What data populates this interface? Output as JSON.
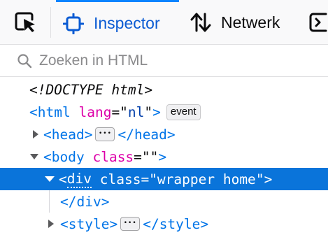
{
  "toolbar": {
    "tabs": [
      {
        "label": "Inspector",
        "icon": "inspector-icon",
        "active": true
      },
      {
        "label": "Netwerk",
        "icon": "network-arrows-icon",
        "active": false
      },
      {
        "label": "",
        "icon": "console-icon",
        "active": false
      }
    ],
    "accent_color": "#0a84ff"
  },
  "search": {
    "placeholder": "Zoeken in HTML",
    "value": ""
  },
  "markup": {
    "doctype": "<!DOCTYPE html>",
    "html_tag": "html",
    "html_attr": "lang",
    "html_val": "nl",
    "event_badge": "event",
    "head_tag": "head",
    "body_tag": "body",
    "body_attr": "class",
    "body_val": "",
    "div_tag": "div",
    "div_attr": "class",
    "div_val": "wrapper home",
    "style_tag": "style",
    "selected_color": "#0a74da"
  }
}
